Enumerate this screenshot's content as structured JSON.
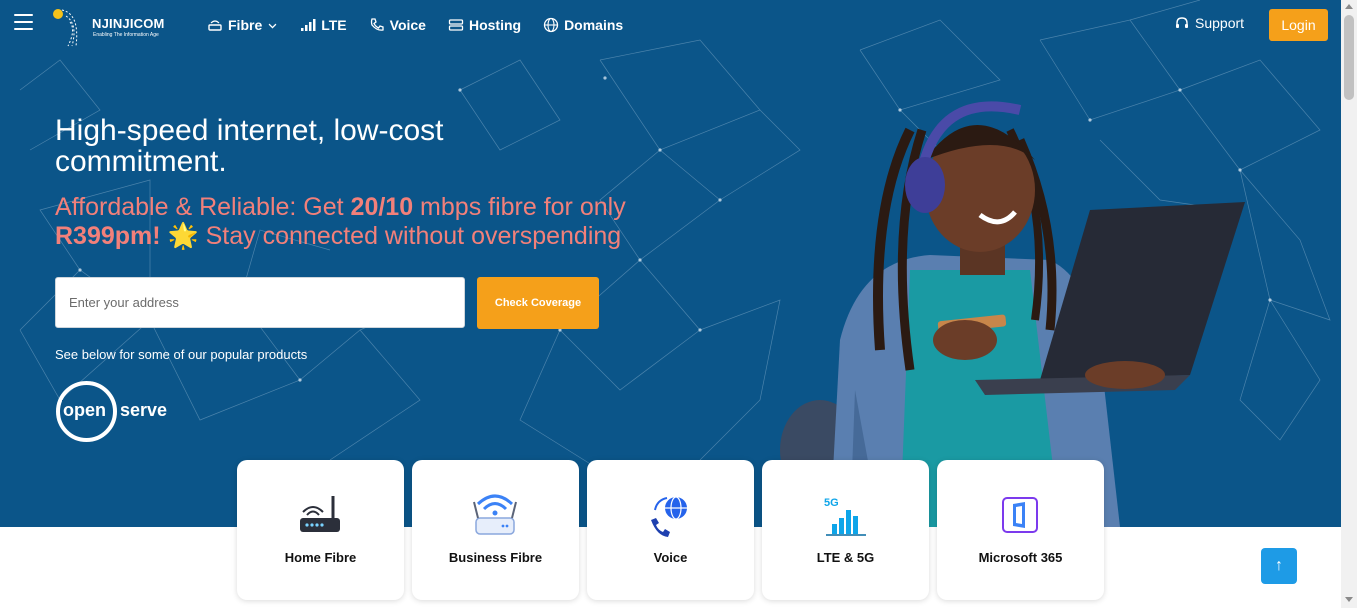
{
  "header": {
    "brand_name": "NJINJICOM",
    "brand_tagline": "Enabling The Information Age",
    "nav": [
      {
        "label": "Fibre",
        "icon": "router-icon",
        "has_dropdown": true
      },
      {
        "label": "LTE",
        "icon": "signal-bars-icon"
      },
      {
        "label": "Voice",
        "icon": "phone-icon"
      },
      {
        "label": "Hosting",
        "icon": "server-icon"
      },
      {
        "label": "Domains",
        "icon": "globe-icon"
      }
    ],
    "support_label": "Support",
    "login_label": "Login"
  },
  "hero": {
    "headline": "High-speed internet, low-cost commitment.",
    "sub_pre": "Affordable & Reliable: Get ",
    "sub_speed": "20/10",
    "sub_mid": " mbps fibre for only ",
    "sub_price": "R399pm!",
    "sub_emoji": "🌟",
    "sub_post": " Stay connected without overspending",
    "address_placeholder": "Enter your address",
    "check_button": "Check Coverage",
    "popular_note": "See below for some of our popular products",
    "partner_open": "open",
    "partner_serve": "serve"
  },
  "products": [
    {
      "label": "Home Fibre",
      "icon": "home-router-icon"
    },
    {
      "label": "Business Fibre",
      "icon": "business-router-icon"
    },
    {
      "label": "Voice",
      "icon": "voip-phone-icon"
    },
    {
      "label": "LTE & 5G",
      "icon": "5g-signal-icon"
    },
    {
      "label": "Microsoft 365",
      "icon": "office-icon"
    }
  ],
  "scroll_top_symbol": "↑",
  "colors": {
    "hero_bg": "#0b5589",
    "accent_orange": "#f5a01a",
    "sub_coral": "#f2807a",
    "scroll_button": "#1e9be6"
  }
}
